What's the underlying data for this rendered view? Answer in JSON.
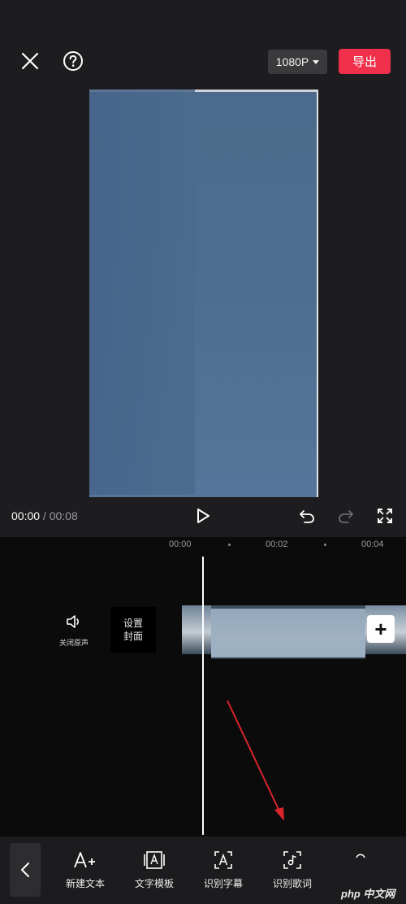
{
  "header": {
    "close_icon": "close-icon",
    "help_icon": "help-icon",
    "resolution": "1080P",
    "export_label": "导出",
    "export_color": "#f0304b"
  },
  "player": {
    "current_time": "00:00",
    "separator": " / ",
    "total_time": "00:08",
    "play_icon": "play-icon",
    "undo_icon": "undo-icon",
    "redo_icon": "redo-icon",
    "fullscreen_icon": "fullscreen-icon"
  },
  "timeline": {
    "ticks": [
      "00:00",
      "00:02",
      "00:04"
    ],
    "mute_label": "关闭原声",
    "cover_label_line1": "设置",
    "cover_label_line2": "封面",
    "add_clip_label": "+"
  },
  "toolbar": {
    "items": [
      {
        "label": "新建文本",
        "icon": "add-text-icon"
      },
      {
        "label": "文字模板",
        "icon": "text-template-icon"
      },
      {
        "label": "识别字幕",
        "icon": "recognize-subtitle-icon"
      },
      {
        "label": "识别歌词",
        "icon": "recognize-lyrics-icon"
      }
    ],
    "back_icon": "chevron-left-icon"
  },
  "watermark": "php 中文网"
}
